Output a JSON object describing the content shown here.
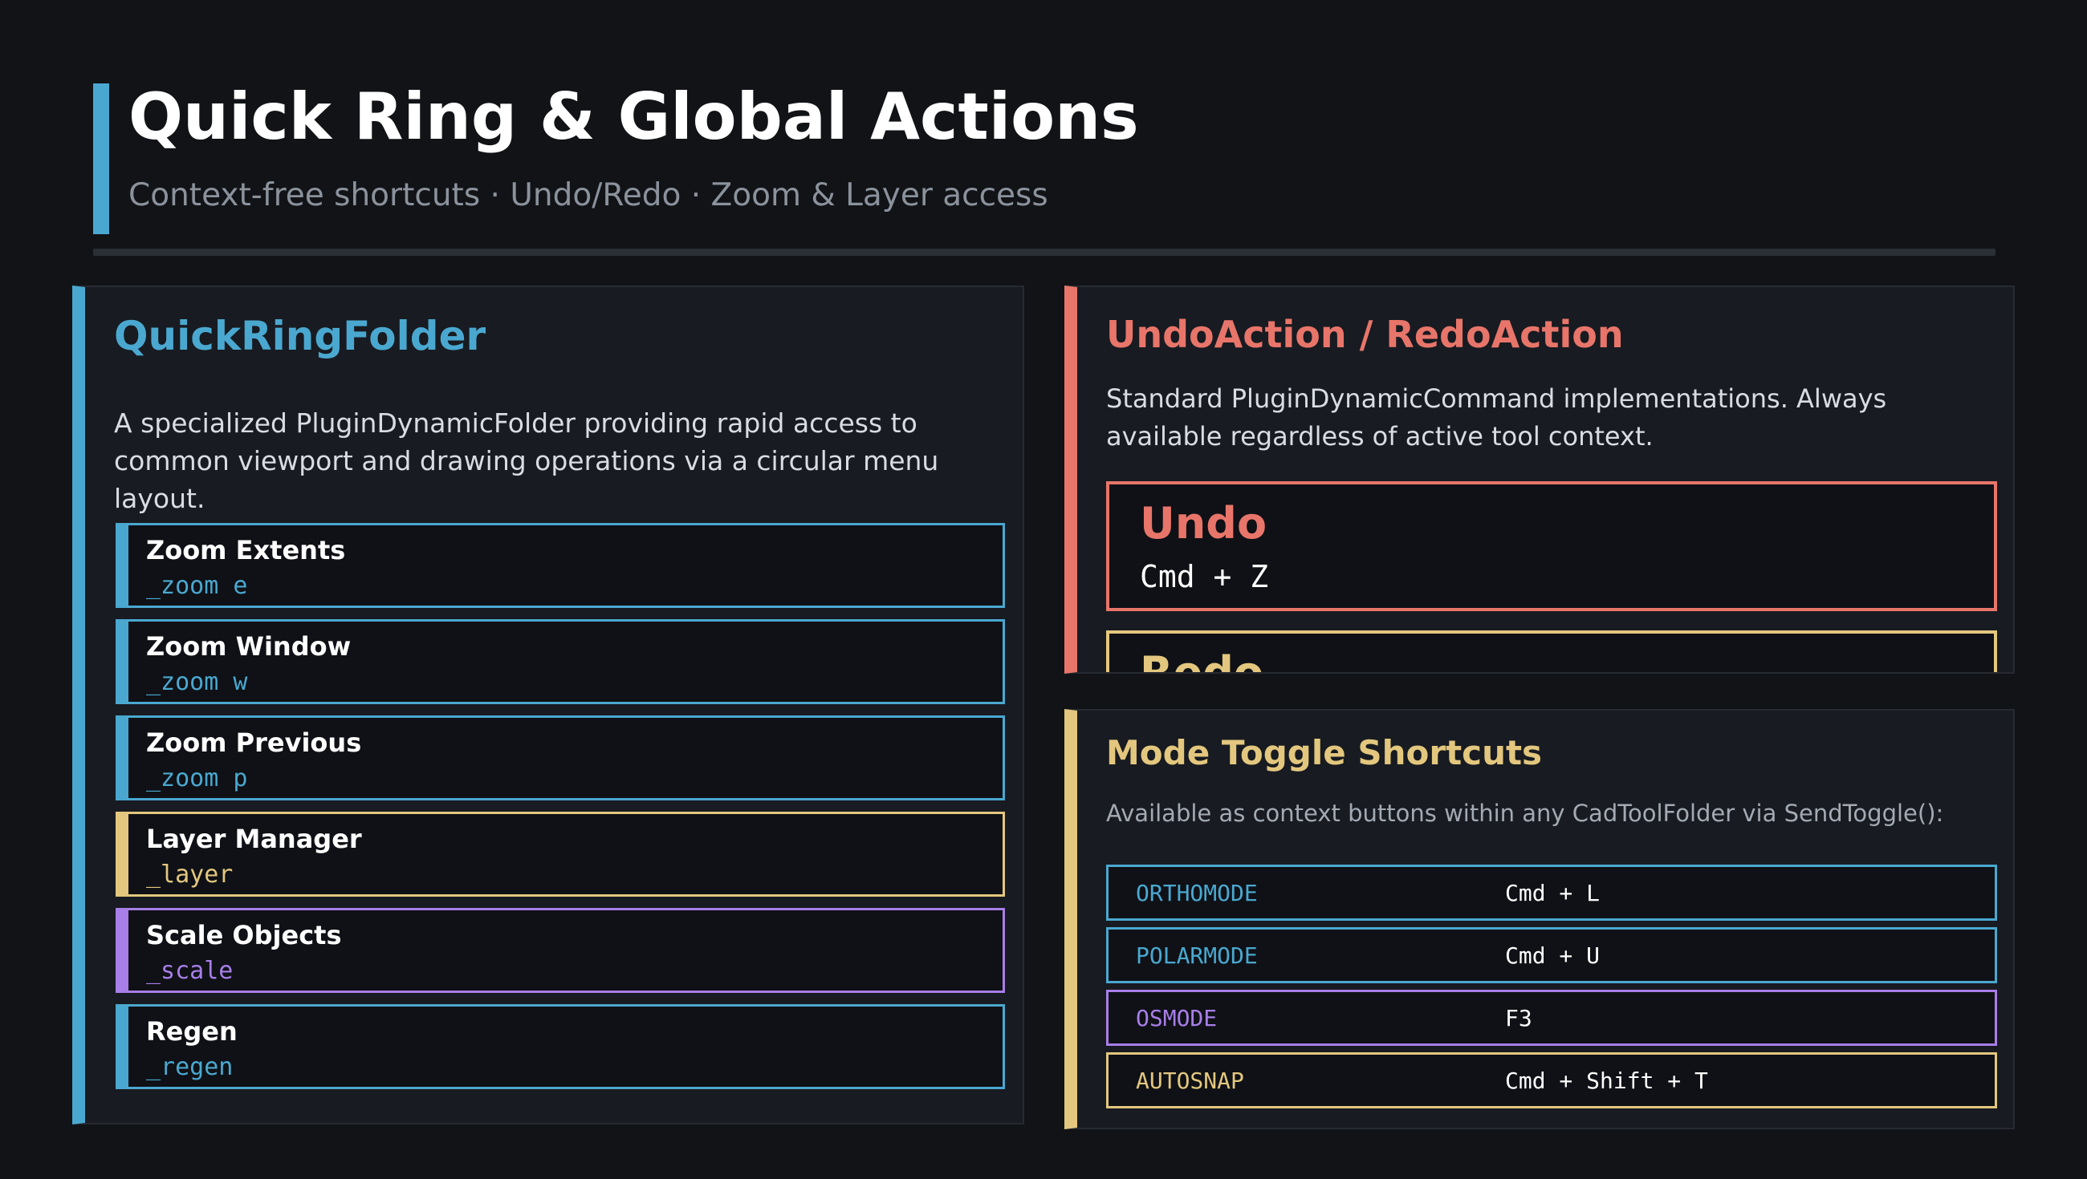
{
  "header": {
    "title": "Quick Ring & Global Actions",
    "subtitle": "Context-free shortcuts · Undo/Redo · Zoom & Layer access"
  },
  "colors": {
    "background": "#111317",
    "panel": "#181b21",
    "blue": "#4aa8d0",
    "red": "#e8756a",
    "yellow": "#e3c77e",
    "purple": "#a87ee8"
  },
  "quick_ring": {
    "title": "QuickRingFolder",
    "description": "A specialized PluginDynamicFolder providing rapid access to common viewport and drawing operations via a circular menu layout.",
    "items": [
      {
        "name": "Zoom Extents",
        "command": "_zoom e",
        "color": "blue"
      },
      {
        "name": "Zoom Window",
        "command": "_zoom w",
        "color": "blue"
      },
      {
        "name": "Zoom Previous",
        "command": "_zoom p",
        "color": "blue"
      },
      {
        "name": "Layer Manager",
        "command": "_layer",
        "color": "yellow"
      },
      {
        "name": "Scale Objects",
        "command": "_scale",
        "color": "purple"
      },
      {
        "name": "Regen",
        "command": "_regen",
        "color": "blue"
      }
    ]
  },
  "undo_redo": {
    "title": "UndoAction / RedoAction",
    "description": "Standard PluginDynamicCommand implementations. Always available regardless of active tool context.",
    "undo": {
      "name": "Undo",
      "keys": "Cmd + Z"
    },
    "redo": {
      "name": "Redo"
    }
  },
  "mode_toggles": {
    "title": "Mode Toggle Shortcuts",
    "description": "Available as context buttons within any CadToolFolder via SendToggle():",
    "rows": [
      {
        "name": "ORTHOMODE",
        "keys": "Cmd + L",
        "color": "blue"
      },
      {
        "name": "POLARMODE",
        "keys": "Cmd + U",
        "color": "blue"
      },
      {
        "name": "OSMODE",
        "keys": "F3",
        "color": "purple"
      },
      {
        "name": "AUTOSNAP",
        "keys": "Cmd + Shift + T",
        "color": "yellow"
      }
    ]
  }
}
